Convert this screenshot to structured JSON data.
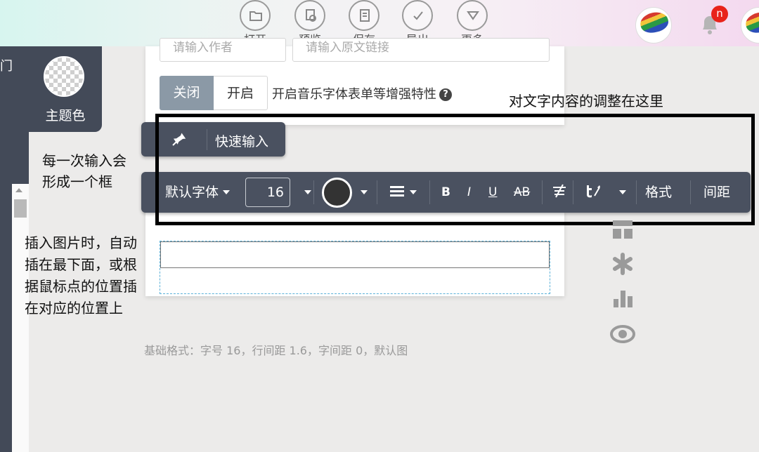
{
  "toolbar": {
    "items": [
      {
        "label": "打开",
        "icon": "folder-icon"
      },
      {
        "label": "预览",
        "icon": "preview-icon"
      },
      {
        "label": "保存",
        "icon": "save-icon"
      },
      {
        "label": "导出",
        "icon": "check-icon"
      },
      {
        "label": "更多",
        "icon": "chevron-down-icon"
      }
    ],
    "notification_count": "n"
  },
  "sidebar": {
    "door_text": "门",
    "theme_label": "主题色"
  },
  "card": {
    "author_placeholder": "请输入作者",
    "link_placeholder": "请输入原文链接",
    "toggle_off": "关闭",
    "toggle_on": "开启",
    "feature_text": "开启音乐字体表单等增强特性"
  },
  "quick_input": {
    "label": "快速输入"
  },
  "format_bar": {
    "font": "默认字体",
    "size": "16",
    "bold": "B",
    "italic": "I",
    "underline": "U",
    "strike": "AB",
    "format": "格式",
    "spacing": "间距"
  },
  "annotations": {
    "top": "对文字内容的调整在这里",
    "left1_line1": "每一次输入会",
    "left1_line2": "形成一个框",
    "left2_line1": "插入图片时，自动",
    "left2_line2": "插在最下面，或根",
    "left2_line3": "据鼠标点的位置插",
    "left2_line4": "在对应的位置上"
  },
  "footer": {
    "basic_format": "基础格式：字号 16，行间距 1.6，字间距 0，默认图"
  },
  "colors": {
    "toolbar_dark": "#4a5160",
    "sidebar_dark": "#434a58",
    "toggle_active": "#8b99a6",
    "badge_red": "#e8231a"
  }
}
